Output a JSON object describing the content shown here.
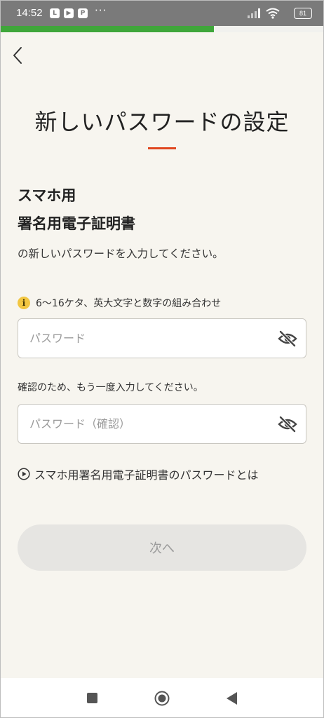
{
  "status_bar": {
    "time": "14:52",
    "more": "···",
    "battery": "81",
    "icons": [
      "line-app-icon",
      "youtube-icon",
      "app-p-icon",
      "signal-icon",
      "wifi-icon",
      "battery-icon"
    ]
  },
  "progress": {
    "fraction": 0.66,
    "color": "#3fa63a"
  },
  "header": {
    "title": "新しいパスワードの設定",
    "accent_color": "#e0461f"
  },
  "certificate": {
    "line1": "スマホ用",
    "line2": "署名用電子証明書"
  },
  "instruction": "の新しいパスワードを入力してください。",
  "password_rule": {
    "icon": "i",
    "text": "6〜16ケタ、英大文字と数字の組み合わせ"
  },
  "password_field": {
    "placeholder": "パスワード",
    "value": ""
  },
  "confirm": {
    "label": "確認のため、もう一度入力してください。",
    "placeholder": "パスワード（確認）",
    "value": ""
  },
  "help_link": {
    "text": "スマホ用署名用電子証明書のパスワードとは"
  },
  "next_button": {
    "label": "次へ"
  }
}
